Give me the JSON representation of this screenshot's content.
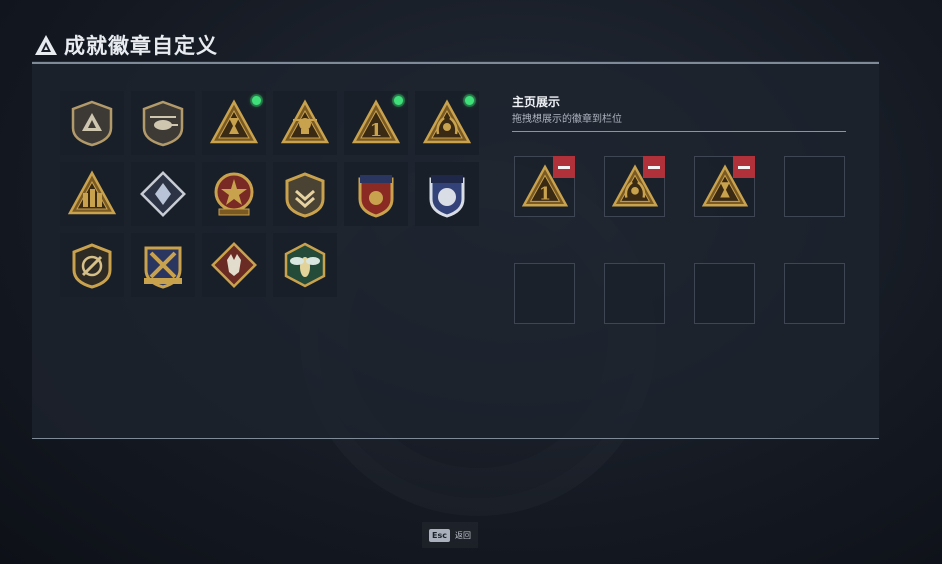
{
  "page": {
    "title": "成就徽章自定义",
    "logo_icon": "triangle-logo-icon"
  },
  "badges": [
    {
      "icon": "shield-triangle-badge-icon",
      "new": false
    },
    {
      "icon": "helicopter-shield-badge-icon",
      "new": false
    },
    {
      "icon": "hourglass-triangle-badge-icon",
      "new": true
    },
    {
      "icon": "skull-triangle-badge-icon",
      "new": false
    },
    {
      "icon": "number-one-triangle-badge-icon",
      "new": true
    },
    {
      "icon": "wreath-triangle-badge-icon",
      "new": true
    },
    {
      "icon": "soldiers-triangle-badge-icon",
      "new": false
    },
    {
      "icon": "diamond-crystal-badge-icon",
      "new": false
    },
    {
      "icon": "star-medal-badge-icon",
      "new": false
    },
    {
      "icon": "chevron-shield-badge-icon",
      "new": false
    },
    {
      "icon": "crest-stars-badge-icon",
      "new": false
    },
    {
      "icon": "eagle-crest-badge-icon",
      "new": false
    },
    {
      "icon": "slash-shield-badge-icon",
      "new": false
    },
    {
      "icon": "crossed-arms-badge-icon",
      "new": false
    },
    {
      "icon": "wolf-diamond-badge-icon",
      "new": false
    },
    {
      "icon": "wasp-hexagon-badge-icon",
      "new": false
    }
  ],
  "showcase": {
    "title": "主页展示",
    "subtitle": "拖拽想展示的徽章到栏位",
    "slots": [
      {
        "filled": true,
        "icon": "number-one-triangle-badge-icon"
      },
      {
        "filled": true,
        "icon": "wreath-triangle-badge-icon"
      },
      {
        "filled": true,
        "icon": "hourglass-triangle-badge-icon"
      },
      {
        "filled": false
      },
      {
        "filled": false
      },
      {
        "filled": false
      },
      {
        "filled": false
      },
      {
        "filled": false
      }
    ]
  },
  "footer": {
    "key": "Esc",
    "label": "返回"
  },
  "colors": {
    "gold": "#c9a24e",
    "gold_dark": "#7a5a22",
    "new_dot": "#3fe07a",
    "remove": "#b0313a",
    "panel_border": "#7f8a99"
  }
}
